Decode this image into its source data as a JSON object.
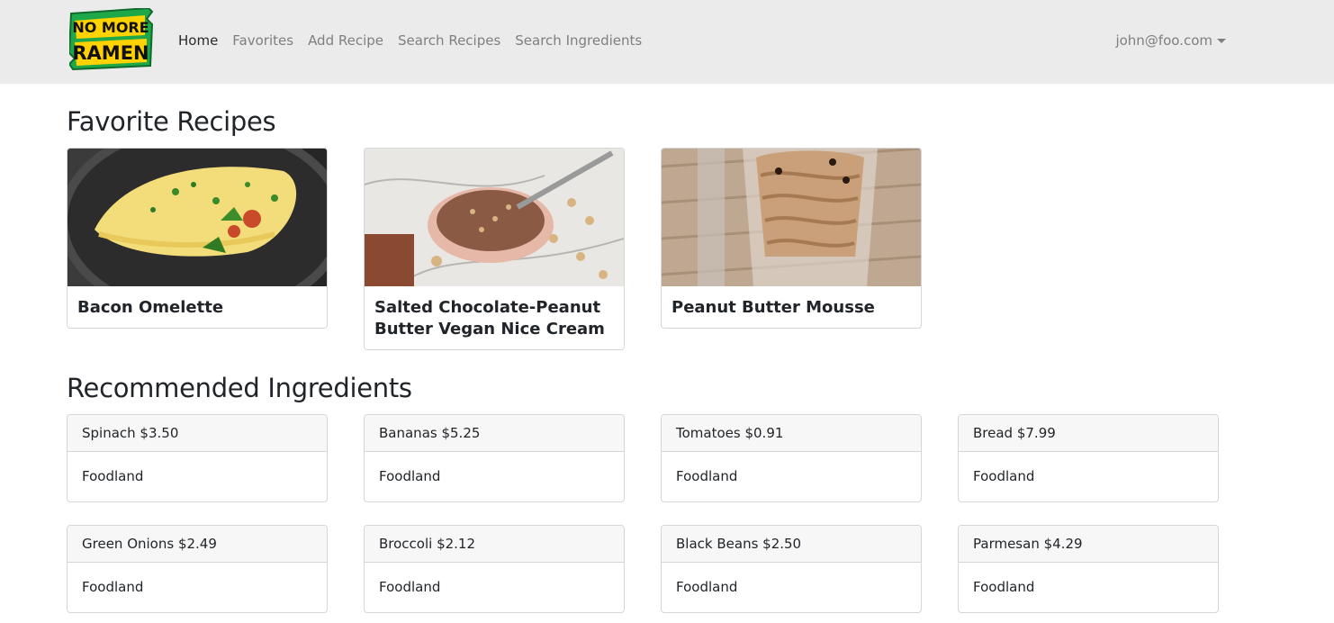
{
  "brand": {
    "logo_line1": "NO MORE",
    "logo_line2": "RAMEN",
    "logo_colors": {
      "green": "#1fa84a",
      "yellow": "#ffd200",
      "text": "#111111"
    }
  },
  "nav": {
    "items": [
      {
        "label": "Home",
        "active": true
      },
      {
        "label": "Favorites"
      },
      {
        "label": "Add Recipe"
      },
      {
        "label": "Search Recipes"
      },
      {
        "label": "Search Ingredients"
      }
    ],
    "user": "john@foo.com"
  },
  "favorites": {
    "title": "Favorite Recipes",
    "recipes": [
      {
        "name": "Bacon Omelette",
        "image": "omelette-photo"
      },
      {
        "name": "Salted Chocolate-Peanut Butter Vegan Nice Cream",
        "image": "chocolate-cream-photo"
      },
      {
        "name": "Peanut Butter Mousse",
        "image": "mousse-photo"
      }
    ]
  },
  "ingredients": {
    "title": "Recommended Ingredients",
    "items": [
      {
        "label": "Spinach $3.50",
        "store": "Foodland"
      },
      {
        "label": "Bananas $5.25",
        "store": "Foodland"
      },
      {
        "label": "Tomatoes $0.91",
        "store": "Foodland"
      },
      {
        "label": "Bread $7.99",
        "store": "Foodland"
      },
      {
        "label": "Green Onions $2.49",
        "store": "Foodland"
      },
      {
        "label": "Broccoli $2.12",
        "store": "Foodland"
      },
      {
        "label": "Black Beans $2.50",
        "store": "Foodland"
      },
      {
        "label": "Parmesan $4.29",
        "store": "Foodland"
      }
    ]
  }
}
